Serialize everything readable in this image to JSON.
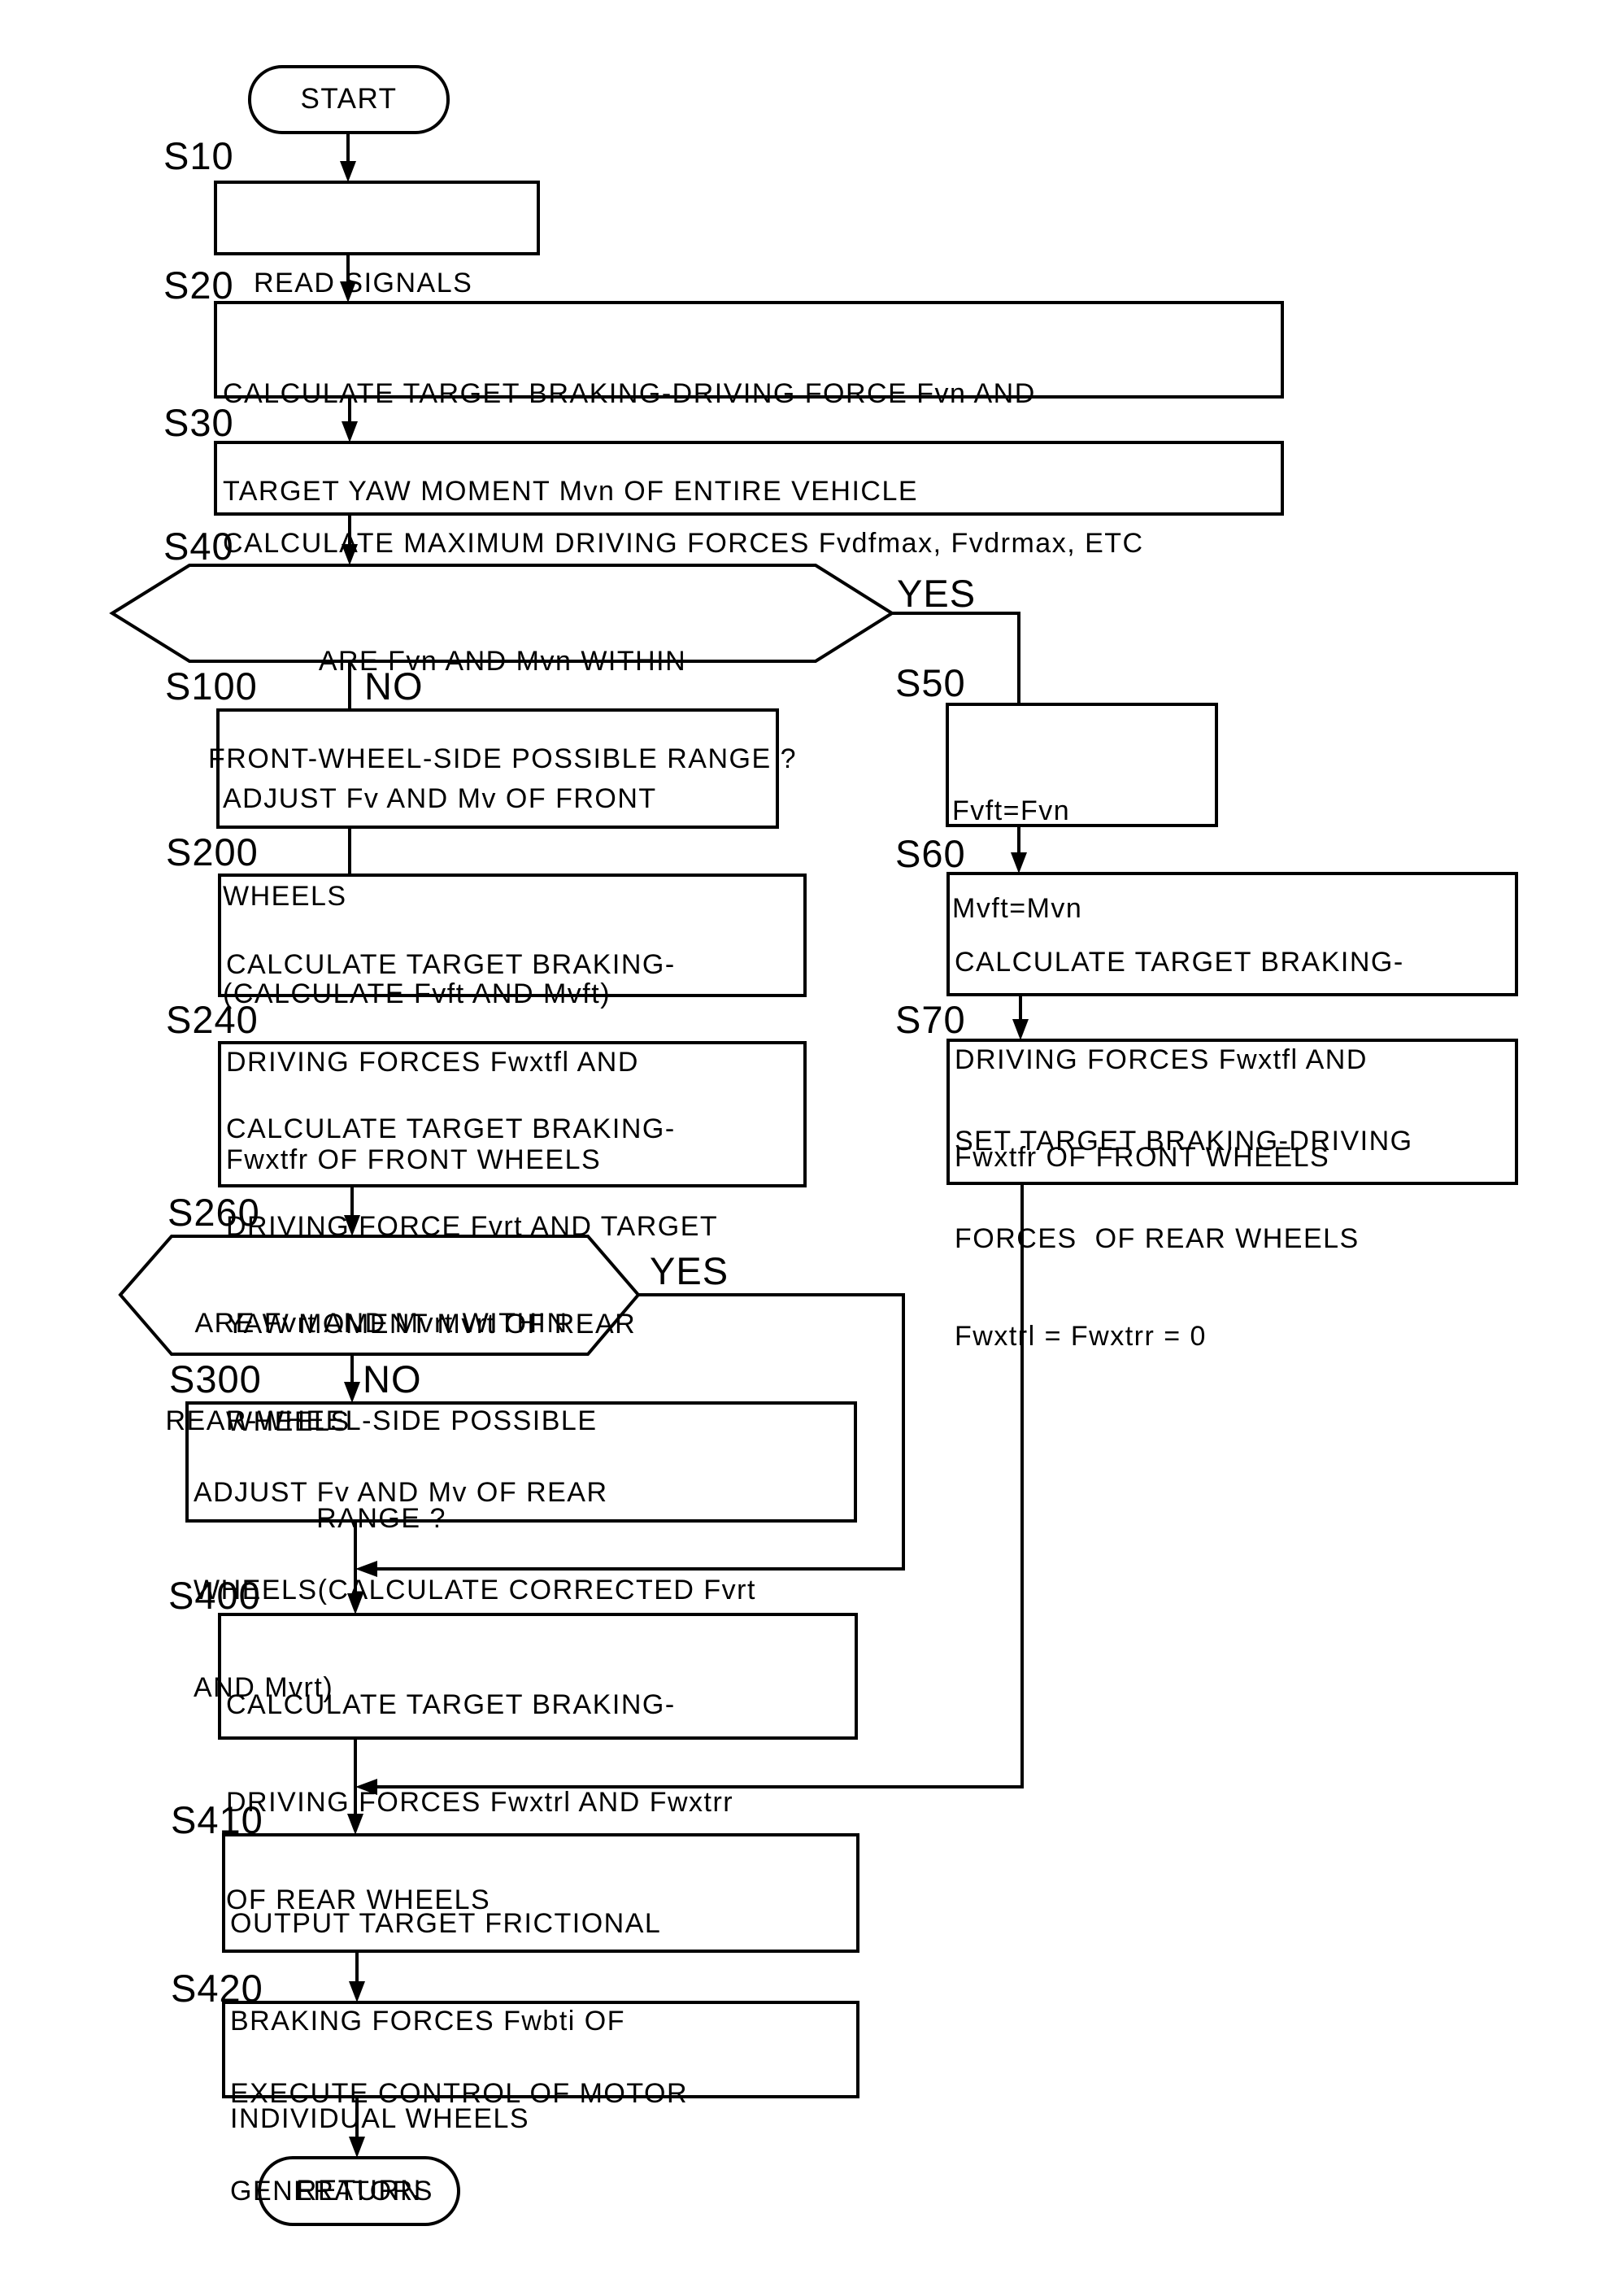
{
  "diagram": {
    "type": "flowchart",
    "terminals": {
      "start": "START",
      "return": "RETURN"
    },
    "steps": [
      {
        "id": "S10",
        "label": "S10",
        "kind": "process",
        "lines": [
          "READ SIGNALS"
        ]
      },
      {
        "id": "S20",
        "label": "S20",
        "kind": "process",
        "lines": [
          "CALCULATE TARGET BRAKING-DRIVING FORCE Fvn AND",
          "TARGET YAW MOMENT Mvn OF ENTIRE VEHICLE"
        ]
      },
      {
        "id": "S30",
        "label": "S30",
        "kind": "process",
        "lines": [
          "CALCULATE MAXIMUM DRIVING FORCES Fvdfmax, Fvdrmax, ETC"
        ]
      },
      {
        "id": "S40",
        "label": "S40",
        "kind": "decision",
        "lines": [
          "ARE Fvn AND Mvn WITHIN",
          "FRONT-WHEEL-SIDE POSSIBLE RANGE ?"
        ]
      },
      {
        "id": "S50",
        "label": "S50",
        "kind": "process",
        "lines": [
          "Fvft=Fvn",
          "Mvft=Mvn"
        ]
      },
      {
        "id": "S60",
        "label": "S60",
        "kind": "process",
        "lines": [
          "CALCULATE TARGET BRAKING-",
          "DRIVING FORCES Fwxtfl AND",
          "Fwxtfr OF FRONT WHEELS"
        ]
      },
      {
        "id": "S70",
        "label": "S70",
        "kind": "process",
        "lines": [
          "SET TARGET BRAKING-DRIVING",
          "FORCES  OF REAR WHEELS",
          "Fwxtrl = Fwxtrr = 0"
        ]
      },
      {
        "id": "S100",
        "label": "S100",
        "kind": "process",
        "lines": [
          "ADJUST Fv AND Mv OF FRONT",
          "WHEELS",
          "(CALCULATE Fvft AND Mvft)"
        ]
      },
      {
        "id": "S200",
        "label": "S200",
        "kind": "process",
        "lines": [
          "CALCULATE TARGET BRAKING-",
          "DRIVING FORCES Fwxtfl AND",
          "Fwxtfr OF FRONT WHEELS"
        ]
      },
      {
        "id": "S240",
        "label": "S240",
        "kind": "process",
        "lines": [
          "CALCULATE TARGET BRAKING-",
          "DRIVING FORCE Fvrt AND TARGET",
          "YAW MOMENT Mvrt OF REAR",
          "WHEELS"
        ]
      },
      {
        "id": "S260",
        "label": "S260",
        "kind": "decision",
        "lines": [
          "ARE Fvrt AND Mvrt WITHIN",
          "REAR-WHEEL-SIDE POSSIBLE",
          "RANGE ?"
        ]
      },
      {
        "id": "S300",
        "label": "S300",
        "kind": "process",
        "lines": [
          "ADJUST Fv AND Mv OF REAR",
          "WHEELS(CALCULATE CORRECTED Fvrt",
          "AND Mvrt)"
        ]
      },
      {
        "id": "S400",
        "label": "S400",
        "kind": "process",
        "lines": [
          "CALCULATE TARGET BRAKING-",
          "DRIVING FORCES Fwxtrl AND Fwxtrr",
          "OF REAR WHEELS"
        ]
      },
      {
        "id": "S410",
        "label": "S410",
        "kind": "process",
        "lines": [
          "OUTPUT TARGET FRICTIONAL",
          "BRAKING FORCES Fwbti OF",
          "INDIVIDUAL WHEELS"
        ]
      },
      {
        "id": "S420",
        "label": "S420",
        "kind": "process",
        "lines": [
          "EXECUTE CONTROL OF MOTOR",
          "GENERATORS"
        ]
      }
    ],
    "branch_labels": {
      "s40_yes": "YES",
      "s40_no": "NO",
      "s260_yes": "YES",
      "s260_no": "NO"
    },
    "edges": [
      {
        "from": "START",
        "to": "S10"
      },
      {
        "from": "S10",
        "to": "S20"
      },
      {
        "from": "S20",
        "to": "S30"
      },
      {
        "from": "S30",
        "to": "S40"
      },
      {
        "from": "S40",
        "to": "S50",
        "label": "YES"
      },
      {
        "from": "S40",
        "to": "S100",
        "label": "NO"
      },
      {
        "from": "S50",
        "to": "S60"
      },
      {
        "from": "S60",
        "to": "S70"
      },
      {
        "from": "S70",
        "to": "S410"
      },
      {
        "from": "S100",
        "to": "S200"
      },
      {
        "from": "S240",
        "to": "S260"
      },
      {
        "from": "S260",
        "to": "S400",
        "label": "YES"
      },
      {
        "from": "S260",
        "to": "S300",
        "label": "NO"
      },
      {
        "from": "S300",
        "to": "S400"
      },
      {
        "from": "S400",
        "to": "S410"
      },
      {
        "from": "S410",
        "to": "S420"
      },
      {
        "from": "S420",
        "to": "RETURN"
      }
    ],
    "colors": {
      "stroke": "#000000",
      "background": "#ffffff",
      "text": "#000000"
    }
  }
}
